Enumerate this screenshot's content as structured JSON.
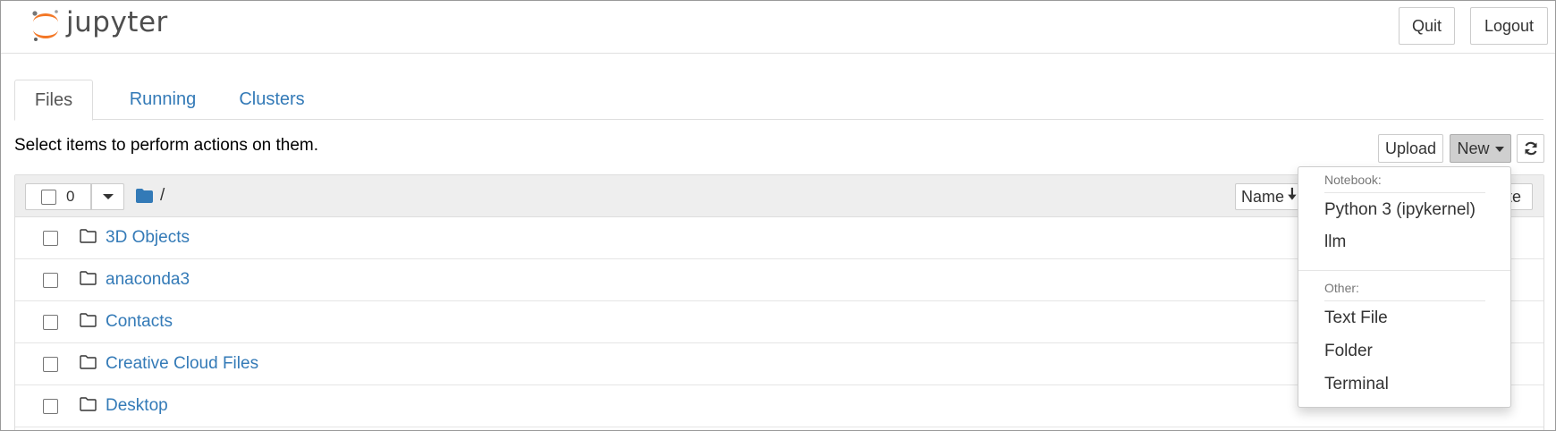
{
  "header": {
    "logo_text": "jupyter",
    "quit_label": "Quit",
    "logout_label": "Logout"
  },
  "tabs": [
    {
      "label": "Files",
      "active": true
    },
    {
      "label": "Running",
      "active": false
    },
    {
      "label": "Clusters",
      "active": false
    }
  ],
  "toolbar": {
    "instructions": "Select items to perform actions on them.",
    "upload_label": "Upload",
    "new_label": "New",
    "refresh_icon": "refresh-icon"
  },
  "listing": {
    "selected_count": "0",
    "breadcrumb_sep": "/",
    "sort_label": "Name",
    "date_label": "te",
    "rows": [
      {
        "name": "3D Objects",
        "icon": "folder-icon"
      },
      {
        "name": "anaconda3",
        "icon": "folder-icon"
      },
      {
        "name": "Contacts",
        "icon": "folder-icon"
      },
      {
        "name": "Creative Cloud Files",
        "icon": "folder-icon"
      },
      {
        "name": "Desktop",
        "icon": "folder-icon"
      }
    ]
  },
  "new_menu": {
    "notebook_header": "Notebook:",
    "notebook_items": [
      "Python 3 (ipykernel)",
      "llm"
    ],
    "other_header": "Other:",
    "other_items": [
      "Text File",
      "Folder",
      "Terminal"
    ]
  },
  "colors": {
    "link": "#337ab7",
    "logo_orange": "#f37726",
    "new_button_active": "#cfcfcf"
  }
}
